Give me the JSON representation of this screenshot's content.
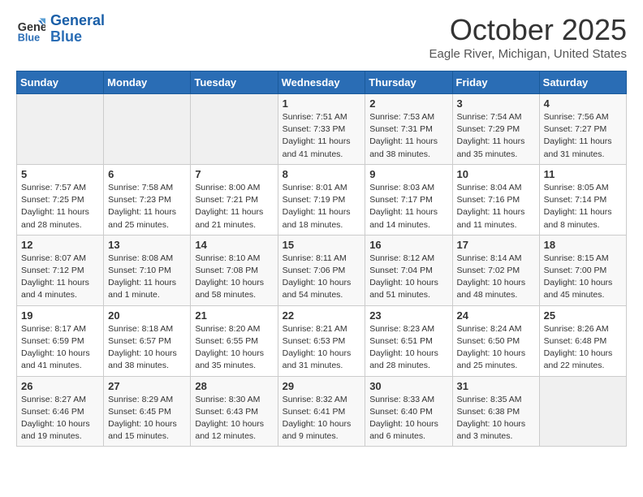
{
  "header": {
    "logo_line1": "General",
    "logo_line2": "Blue",
    "month": "October 2025",
    "location": "Eagle River, Michigan, United States"
  },
  "weekdays": [
    "Sunday",
    "Monday",
    "Tuesday",
    "Wednesday",
    "Thursday",
    "Friday",
    "Saturday"
  ],
  "weeks": [
    [
      {
        "day": "",
        "info": ""
      },
      {
        "day": "",
        "info": ""
      },
      {
        "day": "",
        "info": ""
      },
      {
        "day": "1",
        "info": "Sunrise: 7:51 AM\nSunset: 7:33 PM\nDaylight: 11 hours\nand 41 minutes."
      },
      {
        "day": "2",
        "info": "Sunrise: 7:53 AM\nSunset: 7:31 PM\nDaylight: 11 hours\nand 38 minutes."
      },
      {
        "day": "3",
        "info": "Sunrise: 7:54 AM\nSunset: 7:29 PM\nDaylight: 11 hours\nand 35 minutes."
      },
      {
        "day": "4",
        "info": "Sunrise: 7:56 AM\nSunset: 7:27 PM\nDaylight: 11 hours\nand 31 minutes."
      }
    ],
    [
      {
        "day": "5",
        "info": "Sunrise: 7:57 AM\nSunset: 7:25 PM\nDaylight: 11 hours\nand 28 minutes."
      },
      {
        "day": "6",
        "info": "Sunrise: 7:58 AM\nSunset: 7:23 PM\nDaylight: 11 hours\nand 25 minutes."
      },
      {
        "day": "7",
        "info": "Sunrise: 8:00 AM\nSunset: 7:21 PM\nDaylight: 11 hours\nand 21 minutes."
      },
      {
        "day": "8",
        "info": "Sunrise: 8:01 AM\nSunset: 7:19 PM\nDaylight: 11 hours\nand 18 minutes."
      },
      {
        "day": "9",
        "info": "Sunrise: 8:03 AM\nSunset: 7:17 PM\nDaylight: 11 hours\nand 14 minutes."
      },
      {
        "day": "10",
        "info": "Sunrise: 8:04 AM\nSunset: 7:16 PM\nDaylight: 11 hours\nand 11 minutes."
      },
      {
        "day": "11",
        "info": "Sunrise: 8:05 AM\nSunset: 7:14 PM\nDaylight: 11 hours\nand 8 minutes."
      }
    ],
    [
      {
        "day": "12",
        "info": "Sunrise: 8:07 AM\nSunset: 7:12 PM\nDaylight: 11 hours\nand 4 minutes."
      },
      {
        "day": "13",
        "info": "Sunrise: 8:08 AM\nSunset: 7:10 PM\nDaylight: 11 hours\nand 1 minute."
      },
      {
        "day": "14",
        "info": "Sunrise: 8:10 AM\nSunset: 7:08 PM\nDaylight: 10 hours\nand 58 minutes."
      },
      {
        "day": "15",
        "info": "Sunrise: 8:11 AM\nSunset: 7:06 PM\nDaylight: 10 hours\nand 54 minutes."
      },
      {
        "day": "16",
        "info": "Sunrise: 8:12 AM\nSunset: 7:04 PM\nDaylight: 10 hours\nand 51 minutes."
      },
      {
        "day": "17",
        "info": "Sunrise: 8:14 AM\nSunset: 7:02 PM\nDaylight: 10 hours\nand 48 minutes."
      },
      {
        "day": "18",
        "info": "Sunrise: 8:15 AM\nSunset: 7:00 PM\nDaylight: 10 hours\nand 45 minutes."
      }
    ],
    [
      {
        "day": "19",
        "info": "Sunrise: 8:17 AM\nSunset: 6:59 PM\nDaylight: 10 hours\nand 41 minutes."
      },
      {
        "day": "20",
        "info": "Sunrise: 8:18 AM\nSunset: 6:57 PM\nDaylight: 10 hours\nand 38 minutes."
      },
      {
        "day": "21",
        "info": "Sunrise: 8:20 AM\nSunset: 6:55 PM\nDaylight: 10 hours\nand 35 minutes."
      },
      {
        "day": "22",
        "info": "Sunrise: 8:21 AM\nSunset: 6:53 PM\nDaylight: 10 hours\nand 31 minutes."
      },
      {
        "day": "23",
        "info": "Sunrise: 8:23 AM\nSunset: 6:51 PM\nDaylight: 10 hours\nand 28 minutes."
      },
      {
        "day": "24",
        "info": "Sunrise: 8:24 AM\nSunset: 6:50 PM\nDaylight: 10 hours\nand 25 minutes."
      },
      {
        "day": "25",
        "info": "Sunrise: 8:26 AM\nSunset: 6:48 PM\nDaylight: 10 hours\nand 22 minutes."
      }
    ],
    [
      {
        "day": "26",
        "info": "Sunrise: 8:27 AM\nSunset: 6:46 PM\nDaylight: 10 hours\nand 19 minutes."
      },
      {
        "day": "27",
        "info": "Sunrise: 8:29 AM\nSunset: 6:45 PM\nDaylight: 10 hours\nand 15 minutes."
      },
      {
        "day": "28",
        "info": "Sunrise: 8:30 AM\nSunset: 6:43 PM\nDaylight: 10 hours\nand 12 minutes."
      },
      {
        "day": "29",
        "info": "Sunrise: 8:32 AM\nSunset: 6:41 PM\nDaylight: 10 hours\nand 9 minutes."
      },
      {
        "day": "30",
        "info": "Sunrise: 8:33 AM\nSunset: 6:40 PM\nDaylight: 10 hours\nand 6 minutes."
      },
      {
        "day": "31",
        "info": "Sunrise: 8:35 AM\nSunset: 6:38 PM\nDaylight: 10 hours\nand 3 minutes."
      },
      {
        "day": "",
        "info": ""
      }
    ]
  ]
}
